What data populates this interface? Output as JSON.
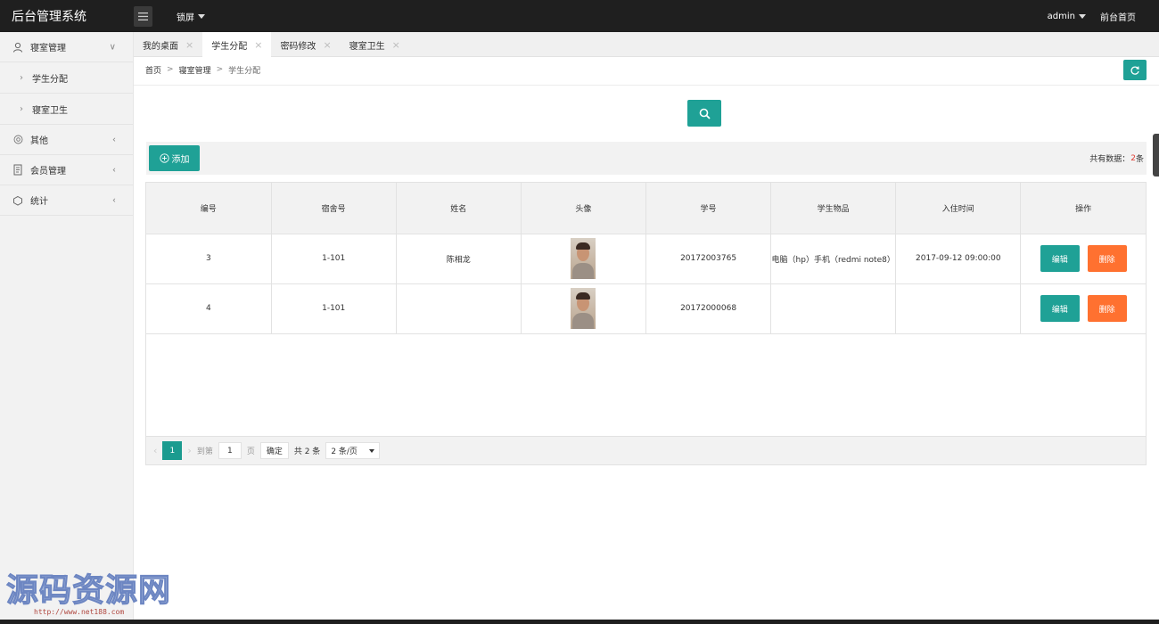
{
  "header": {
    "title": "后台管理系统",
    "lock_label": "锁屏",
    "user_label": "admin",
    "home_label": "前台首页"
  },
  "sidebar": {
    "items": [
      {
        "label": "寝室管理",
        "icon": "user-icon",
        "arrow": "∨"
      },
      {
        "label": "学生分配",
        "sub": true
      },
      {
        "label": "寝室卫生",
        "sub": true
      },
      {
        "label": "其他",
        "icon": "at-icon",
        "arrow": "‹"
      },
      {
        "label": "会员管理",
        "icon": "doc-icon",
        "arrow": "‹"
      },
      {
        "label": "统计",
        "icon": "chart-icon",
        "arrow": "‹"
      }
    ]
  },
  "tabs": [
    {
      "label": "我的桌面",
      "active": false
    },
    {
      "label": "学生分配",
      "active": true
    },
    {
      "label": "密码修改",
      "active": false
    },
    {
      "label": "寝室卫生",
      "active": false
    }
  ],
  "breadcrumb": {
    "home": "首页",
    "section": "寝室管理",
    "current": "学生分配",
    "sep": ">"
  },
  "toolbar": {
    "add_label": "添加",
    "total_label": "共有数据：",
    "total_count": "2",
    "total_unit": "条"
  },
  "table": {
    "headers": [
      "编号",
      "宿舍号",
      "姓名",
      "头像",
      "学号",
      "学生物品",
      "入住时间",
      "操作"
    ],
    "rows": [
      {
        "id": "3",
        "room": "1-101",
        "name": "陈相龙",
        "student_no": "20172003765",
        "items": "电脑（hp）手机（redmi note8）",
        "checkin": "2017-09-12 09:00:00",
        "edit": "编辑",
        "delete": "删除"
      },
      {
        "id": "4",
        "room": "1-101",
        "name": "",
        "student_no": "20172000068",
        "items": "",
        "checkin": "",
        "edit": "编辑",
        "delete": "删除"
      }
    ]
  },
  "pager": {
    "prev": "‹",
    "current": "1",
    "next": "›",
    "goto_label": "到第",
    "goto_value": "1",
    "page_label": "页",
    "confirm": "确定",
    "total": "共 2 条",
    "per_page": "2 条/页"
  },
  "watermark": {
    "text": "源码资源网",
    "url": "http://www.net188.com"
  },
  "colors": {
    "primary": "#1fa196",
    "danger": "#ff7130",
    "header_bg": "#1f1f1f",
    "count_red": "#e03c32"
  }
}
